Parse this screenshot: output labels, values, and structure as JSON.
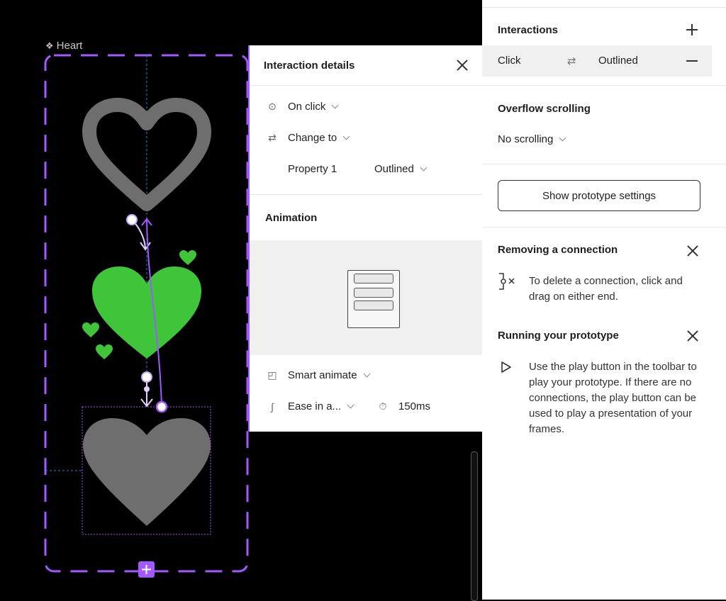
{
  "canvas": {
    "frame_label": "Heart",
    "colors": {
      "accent": "#a259ff",
      "green": "#3fc43a",
      "gray": "#6e6e6e",
      "guide": "#1b8ad8"
    }
  },
  "interaction_details": {
    "title": "Interaction details",
    "trigger": "On click",
    "action": "Change to",
    "property_label": "Property 1",
    "property_value": "Outlined",
    "animation_title": "Animation",
    "animation_type": "Smart animate",
    "easing": "Ease in a...",
    "duration": "150ms"
  },
  "panel": {
    "interactions_title": "Interactions",
    "interaction_row": {
      "trigger": "Click",
      "target": "Outlined"
    },
    "overflow_title": "Overflow scrolling",
    "overflow_value": "No scrolling",
    "settings_button": "Show prototype settings",
    "tips": [
      {
        "title": "Removing a connection",
        "text": "To delete a connection, click and drag on either end."
      },
      {
        "title": "Running your prototype",
        "text": "Use the play button in the toolbar to play your prototype. If there are no connections, the play button can be used to play a presentation of your frames."
      }
    ]
  }
}
